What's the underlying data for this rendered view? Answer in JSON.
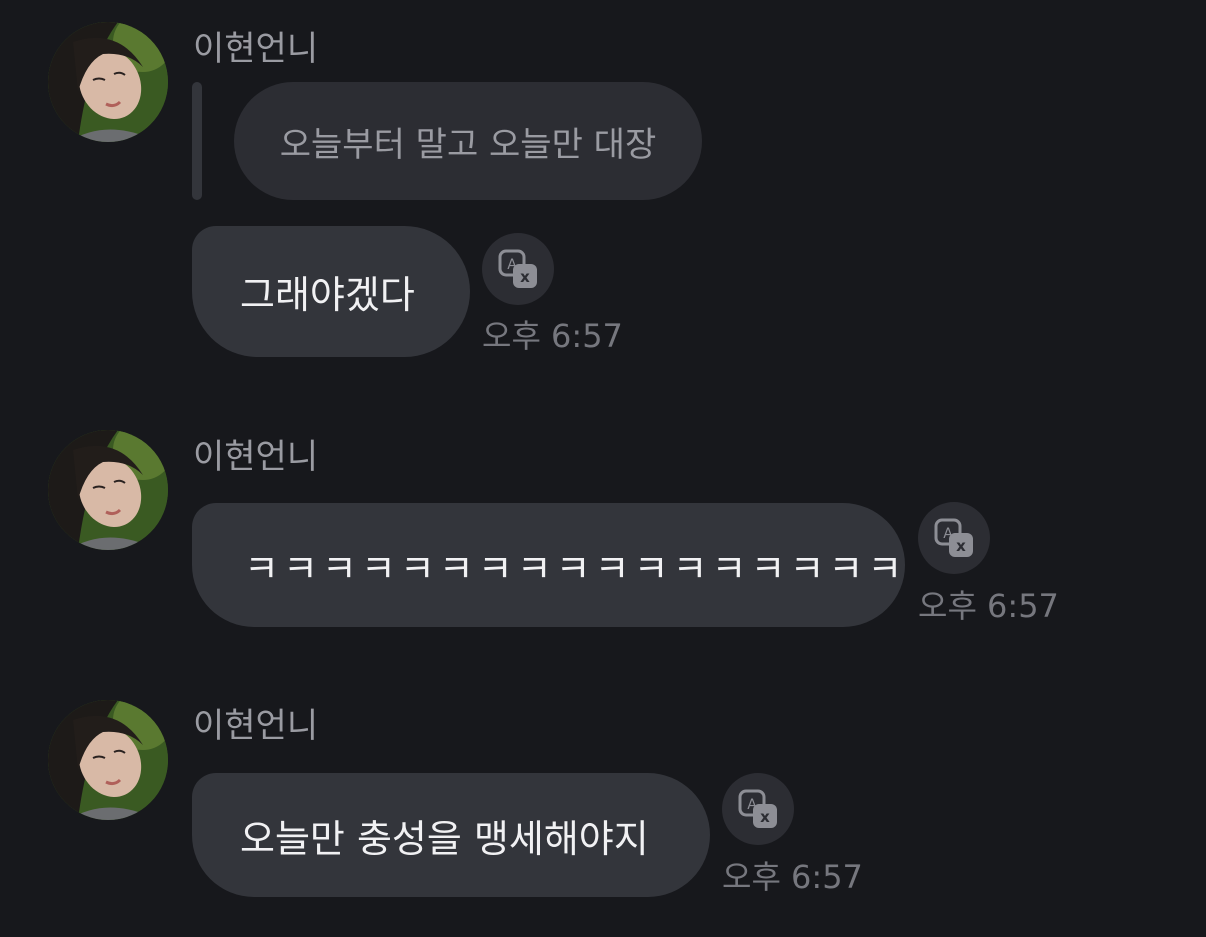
{
  "messages": [
    {
      "sender": "이현언니",
      "reply_quote": "오늘부터 말고 오늘만 대장",
      "text": "그래야겠다",
      "time": "오후 6:57"
    },
    {
      "sender": "이현언니",
      "text": "ㅋㅋㅋㅋㅋㅋㅋㅋㅋㅋㅋㅋㅋㅋㅋㅋㅋ",
      "time": "오후 6:57"
    },
    {
      "sender": "이현언니",
      "text": "오늘만 충성을 맹세해야지",
      "time": "오후 6:57"
    }
  ],
  "icons": {
    "translate": "translate-icon",
    "avatar": "avatar"
  },
  "colors": {
    "background": "#17181c",
    "bubble": "#33353b",
    "quote_bubble": "#2c2d33",
    "name": "#9a9ba2",
    "timestamp": "#76777e"
  }
}
